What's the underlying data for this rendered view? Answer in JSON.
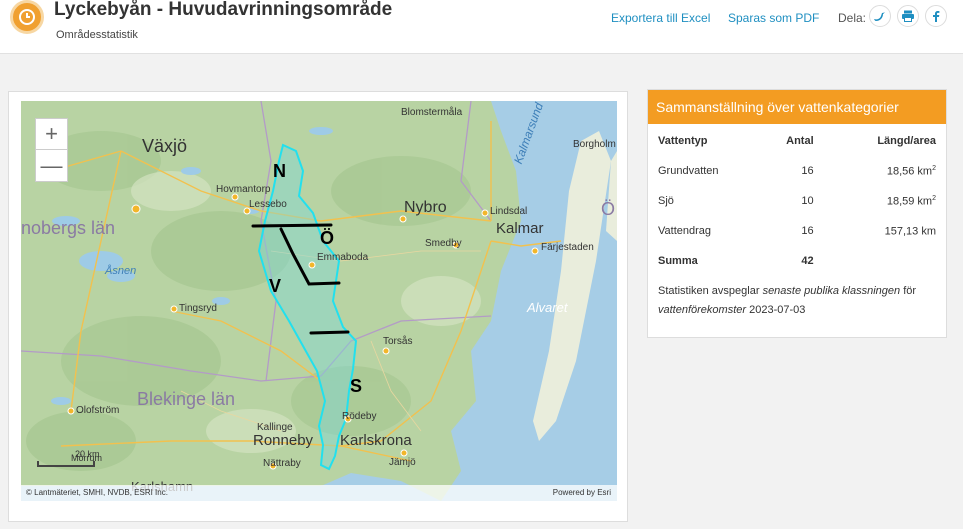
{
  "header": {
    "title": "Lyckebyån - Huvudavrinningsområde",
    "subtitle": "Områdesstatistik",
    "export_excel": "Exportera till Excel",
    "save_pdf": "Sparas som PDF",
    "share_label": "Dela:"
  },
  "map": {
    "labels": {
      "vaxjo": "Växjö",
      "hovmantorp": "Hovmantorp",
      "lessebo": "Lessebo",
      "blomstermala": "Blomstermåla",
      "nybro": "Nybro",
      "lindsdal": "Lindsdal",
      "kalmar": "Kalmar",
      "farjestaden": "Färjestaden",
      "smedby": "Smedby",
      "emmaboda": "Emmaboda",
      "kronobergs_lan": "nobergs län",
      "asnen": "Åsnen",
      "tingsryd": "Tingsryd",
      "torsas": "Torsås",
      "alvaret": "Alvaret",
      "kalmarsund": "Kalmarsund",
      "borgholm": "Borgholm",
      "o_edge": "Ö",
      "olofstrom": "Olofström",
      "blekinge_lan": "Blekinge län",
      "kallinge": "Kallinge",
      "ronneby": "Ronneby",
      "rodeby": "Rödeby",
      "karlskrona": "Karlskrona",
      "nattraby": "Nättraby",
      "jamjo": "Jämjö",
      "karlshamn": "Karlshamn",
      "morrum": "Mörrum"
    },
    "zone_labels": {
      "n": "N",
      "o": "Ö",
      "v": "V",
      "s": "S"
    },
    "scale_label": "20 km",
    "attribution": "© Lantmäteriet, SMHI, NVDB, ESRI Inc.",
    "powered_by": "Powered by Esri",
    "zoom_in": "+",
    "zoom_out": "—"
  },
  "stats": {
    "heading": "Sammanställning över vattenkategorier",
    "columns": [
      "Vattentyp",
      "Antal",
      "Längd/area"
    ],
    "rows": [
      {
        "type": "Grundvatten",
        "count": "16",
        "value": "18,56 km",
        "sup": "2"
      },
      {
        "type": "Sjö",
        "count": "10",
        "value": "18,59 km",
        "sup": "2"
      },
      {
        "type": "Vattendrag",
        "count": "16",
        "value": "157,13 km",
        "sup": ""
      }
    ],
    "sum_label": "Summa",
    "sum_count": "42",
    "note_prefix": "Statistiken avspeglar ",
    "note_italic1": "senaste publika klassningen",
    "note_mid": " för ",
    "note_italic2": "vattenförekomster",
    "note_suffix": " 2023-07-03"
  }
}
